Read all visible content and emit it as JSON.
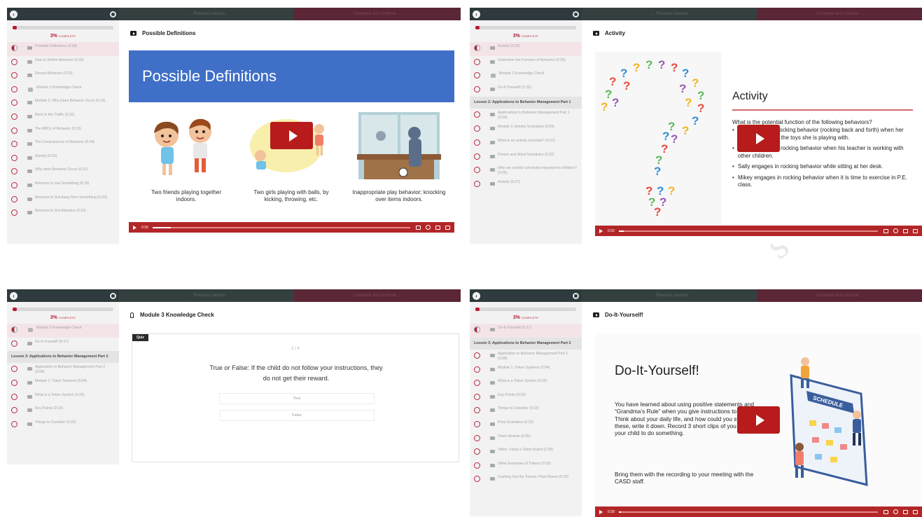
{
  "watermark": "s in",
  "panels": [
    {
      "topbar": {
        "previous": "← Previous Lecture",
        "complete": "Complete and continue →"
      },
      "progress": {
        "percent": "3%",
        "word": "COMPLETE",
        "fraction": 0.03
      },
      "sidebar": [
        {
          "label": "Possible Definitions (0:28)",
          "icon": "video",
          "active": true
        },
        {
          "label": "How to Define Behavior (0:29)",
          "icon": "video"
        },
        {
          "label": "Record Behavior (0:23)",
          "icon": "video"
        },
        {
          "label": "Module 1 Knowledge Check",
          "icon": "bulb"
        },
        {
          "label": "Module 2: Why Does Behavior Occur (0:18)",
          "icon": "video"
        },
        {
          "label": "Back to the Traffic (0:32)",
          "icon": "video"
        },
        {
          "label": "The ABCs of Behavior (0:23)",
          "icon": "video"
        },
        {
          "label": "The Consequence of Behavior (0:34)",
          "icon": "video"
        },
        {
          "label": "Activity (0:20)",
          "icon": "video"
        },
        {
          "label": "Why does Behavior Occur (0:31)",
          "icon": "video"
        },
        {
          "label": "Behavior to Get Something (0:18)",
          "icon": "video"
        },
        {
          "label": "Behavior to Get Away from Something (0:23)",
          "icon": "video"
        },
        {
          "label": "Behavior to Get Attention (0:19)",
          "icon": "video"
        }
      ],
      "title": "Possible Definitions",
      "slide": {
        "banner": "Possible Definitions",
        "captions": [
          "Two friends playing together indoors.",
          "Two girls playing with balls, by kicking, throwing, etc.",
          "Inappropriate play behavior; knocking over items indoors."
        ]
      },
      "video": {
        "time": "0:30",
        "progress": 0.07
      }
    },
    {
      "topbar": {
        "previous": "← Previous Lecture",
        "complete": "Complete and continue →"
      },
      "progress": {
        "percent": "3%",
        "word": "COMPLETE",
        "fraction": 0.03
      },
      "sidebar": [
        {
          "label": "Activity (0:33)",
          "icon": "video",
          "active": true
        },
        {
          "label": "Determine the Function of Behavior (0:25)",
          "icon": "video"
        },
        {
          "label": "Module 2 Knowledge Check",
          "icon": "bulb"
        },
        {
          "label": "Do-It-Yourself! (2:16)",
          "icon": "video"
        },
        {
          "lesson": "Lesson 2: Applications to Behavior Management Part 1"
        },
        {
          "label": "Applications to Behavior Management Part 1 (0:09)",
          "icon": "video"
        },
        {
          "label": "Module 1: Activity Schedules (0:09)",
          "icon": "video"
        },
        {
          "label": "What is an activity schedule? (0:22)",
          "icon": "video"
        },
        {
          "label": "Picture and Word Schedules (0:22)",
          "icon": "video"
        },
        {
          "label": "Why are activity schedules important to children? (0:25)",
          "icon": "video"
        },
        {
          "label": "Activity (0:27)",
          "icon": "video"
        }
      ],
      "title": "Activity",
      "slide": {
        "heading": "Activity",
        "question": "What is the potential function of the following behaviors?",
        "bullets": [
          "Tim engages in rocking behavior (rocking back and forth) when her teacher removes the toys she is playing with.",
          "John engages in rocking behavior when his teacher is working with other children.",
          "Sally engages in rocking behavior while sitting at her desk.",
          "Mikey engages in rocking behavior when it is time to exercise in P.E. class."
        ]
      },
      "video": {
        "time": "0:33",
        "progress": 0.02
      }
    },
    {
      "topbar": {
        "previous": "← Previous Lecture",
        "complete": "Complete and continue →"
      },
      "progress": {
        "percent": "3%",
        "word": "COMPLETE",
        "fraction": 0.03
      },
      "sidebar": [
        {
          "label": "Module 3 Knowledge Check",
          "icon": "bulb",
          "active": true
        },
        {
          "label": "Do-It-Yourself! (0:27)",
          "icon": "video"
        },
        {
          "lesson": "Lesson 3: Applications to Behavior Management Part 2"
        },
        {
          "label": "Application to Behavior Management Part 2 (0:08)",
          "icon": "video"
        },
        {
          "label": "Module 1: Token Systems (0:04)",
          "icon": "video"
        },
        {
          "label": "What is a Token System (0:26)",
          "icon": "video"
        },
        {
          "label": "Key Points (0:23)",
          "icon": "video"
        },
        {
          "label": "Things to Consider (0:23)",
          "icon": "video"
        }
      ],
      "title": "Module 3 Knowledge Check",
      "quiz": {
        "tag": "Quiz",
        "count": "1 / 4",
        "question": "True or False: If the child do not follow your instructions, they do not get their reward.",
        "options": [
          "True",
          "False"
        ]
      }
    },
    {
      "topbar": {
        "previous": "← Previous Lecture",
        "complete": "Complete and continue →"
      },
      "progress": {
        "percent": "3%",
        "word": "COMPLETE",
        "fraction": 0.03
      },
      "sidebar": [
        {
          "label": "Do-It-Yourself! (0:27)",
          "icon": "video",
          "active": true
        },
        {
          "lesson": "Lesson 3: Applications to Behavior Management Part 2"
        },
        {
          "label": "Application to Behavior Management Part 2 (0:08)",
          "icon": "video"
        },
        {
          "label": "Module 1: Token Systems (0:04)",
          "icon": "video"
        },
        {
          "label": "What is a Token System (0:26)",
          "icon": "video"
        },
        {
          "label": "Key Points (0:23)",
          "icon": "video"
        },
        {
          "label": "Things to Consider (0:23)",
          "icon": "video"
        },
        {
          "label": "Prize Examples (0:23)",
          "icon": "video"
        },
        {
          "label": "Token Boards (0:35)",
          "icon": "video"
        },
        {
          "label": "Video: Using a Token Board (2:39)",
          "icon": "video"
        },
        {
          "label": "Other Examples of Tokens (0:23)",
          "icon": "video"
        },
        {
          "label": "Cashing Out the Tokens: Prize Boxes (0:23)",
          "icon": "video"
        }
      ],
      "title": "Do-It-Yourself!",
      "slide": {
        "heading": "Do-It-Yourself!",
        "body": "You have learned about using positive statements and “Grandma’s Rule” when you give instructions to your child. Think about your daily life, and how could you start to use these, write it down. Record 3 short clips of you instructing your child to do something.",
        "footer": "Bring them with the recording to your meeting with the CASD staff.",
        "schedule_word": "SCHEDULE"
      },
      "video": {
        "time": "0:28",
        "progress": 0.01
      }
    }
  ]
}
